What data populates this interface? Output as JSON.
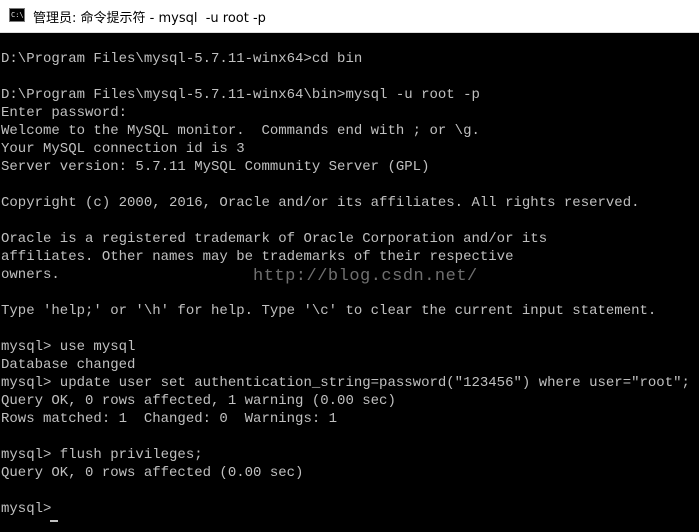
{
  "window": {
    "title": "管理员: 命令提示符 - mysql  -u root -p",
    "icon_label": "C:\\",
    "icon": "console-icon"
  },
  "console": {
    "lines": [
      "",
      "D:\\Program Files\\mysql-5.7.11-winx64>cd bin",
      "",
      "D:\\Program Files\\mysql-5.7.11-winx64\\bin>mysql -u root -p",
      "Enter password:",
      "Welcome to the MySQL monitor.  Commands end with ; or \\g.",
      "Your MySQL connection id is 3",
      "Server version: 5.7.11 MySQL Community Server (GPL)",
      "",
      "Copyright (c) 2000, 2016, Oracle and/or its affiliates. All rights reserved.",
      "",
      "Oracle is a registered trademark of Oracle Corporation and/or its",
      "affiliates. Other names may be trademarks of their respective",
      "owners.",
      "",
      "Type 'help;' or '\\h' for help. Type '\\c' to clear the current input statement.",
      "",
      "mysql> use mysql",
      "Database changed",
      "mysql> update user set authentication_string=password(\"123456\") where user=\"root\";",
      "Query OK, 0 rows affected, 1 warning (0.00 sec)",
      "Rows matched: 1  Changed: 0  Warnings: 1",
      "",
      "mysql> flush privileges;",
      "Query OK, 0 rows affected (0.00 sec)",
      "",
      "mysql>"
    ],
    "watermark": "http://blog.csdn.net/"
  },
  "colors": {
    "background": "#000000",
    "text": "#c0c0c0",
    "titlebar": "#ffffff"
  }
}
